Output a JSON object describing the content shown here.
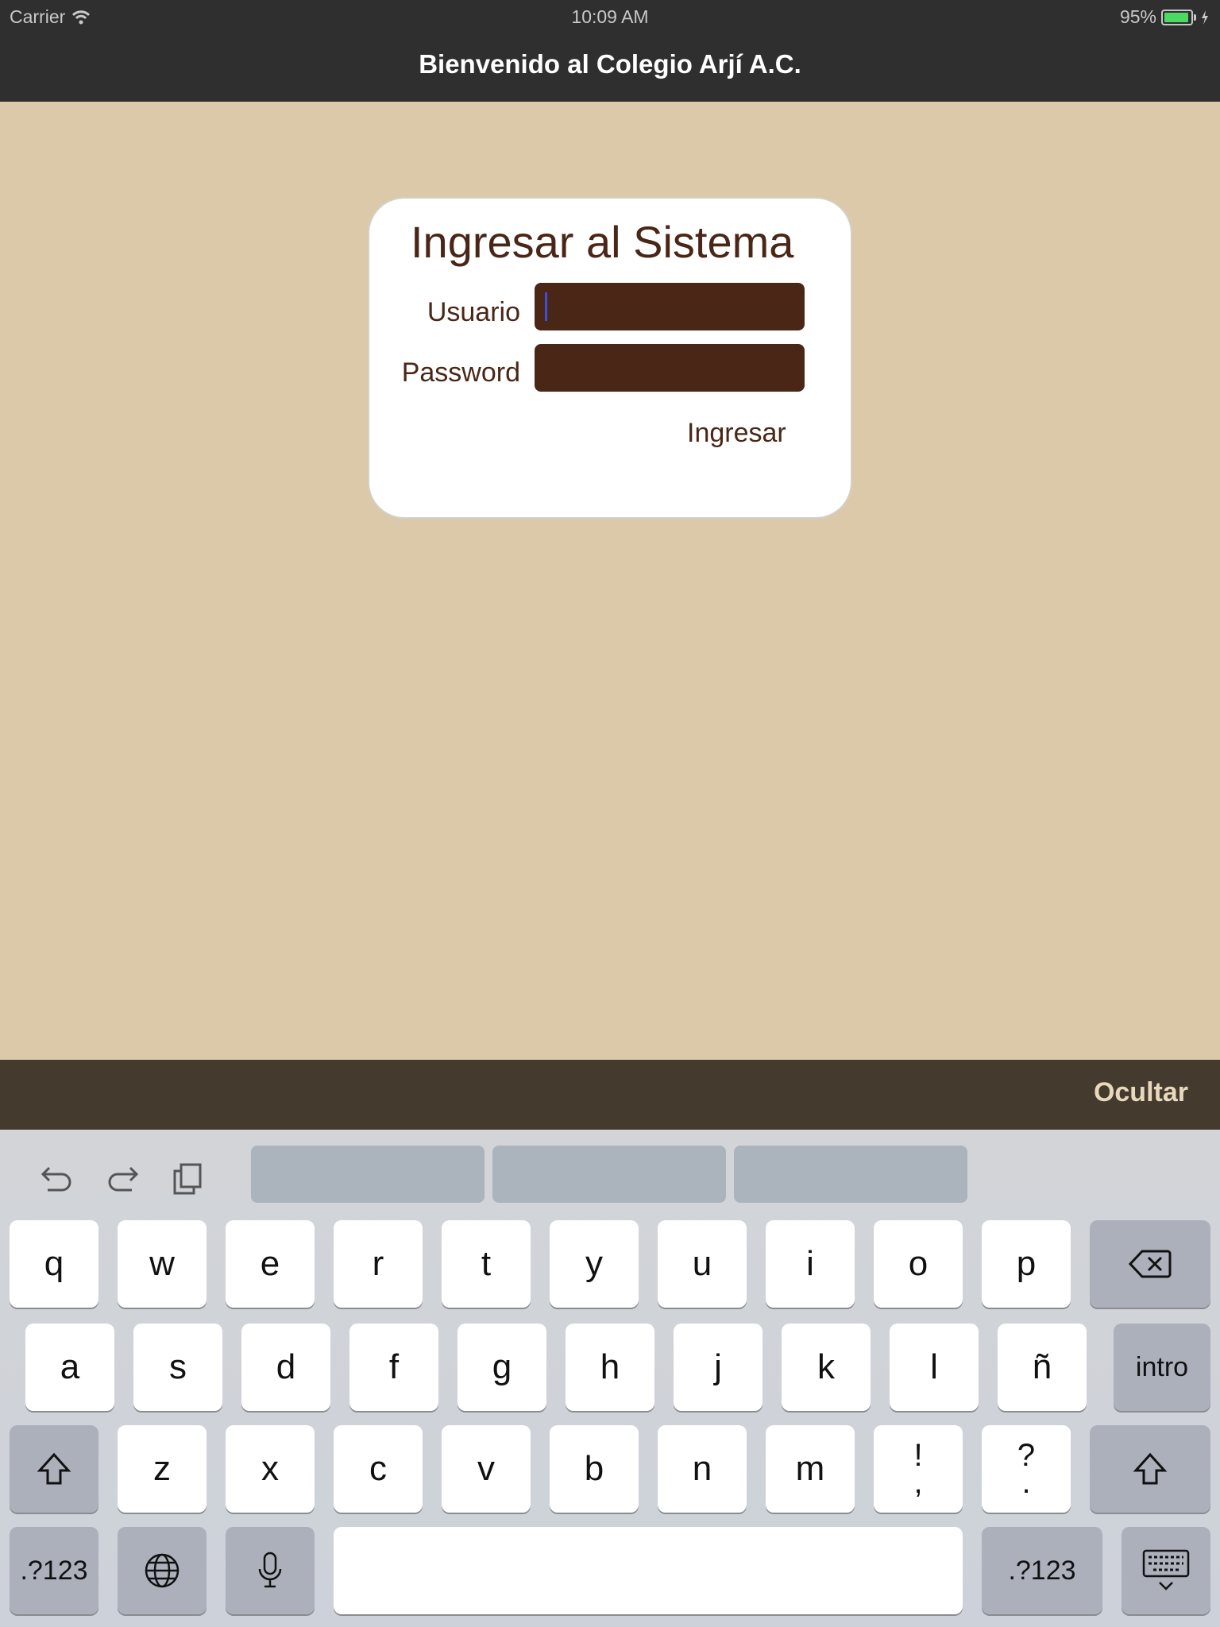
{
  "status_bar": {
    "carrier": "Carrier",
    "time": "10:09 AM",
    "battery": "95%",
    "battery_level": 0.95
  },
  "nav": {
    "title": "Bienvenido al Colegio Arjí A.C."
  },
  "login": {
    "title": "Ingresar al Sistema",
    "user_label": "Usuario",
    "user_value": "",
    "password_label": "Password",
    "password_value": "",
    "submit_label": "Ingresar"
  },
  "accessory": {
    "hide_label": "Ocultar"
  },
  "keyboard": {
    "row1": [
      "q",
      "w",
      "e",
      "r",
      "t",
      "y",
      "u",
      "i",
      "o",
      "p"
    ],
    "row2": [
      "a",
      "s",
      "d",
      "f",
      "g",
      "h",
      "j",
      "k",
      "l",
      "ñ"
    ],
    "row2_return": "intro",
    "row3": [
      "z",
      "x",
      "c",
      "v",
      "b",
      "n",
      "m"
    ],
    "row3_punct": [
      {
        "top": "!",
        "bottom": ","
      },
      {
        "top": "?",
        "bottom": "."
      }
    ],
    "numbers_label": ".?123"
  },
  "colors": {
    "background": "#dbc9a9",
    "brand_brown": "#4a2617",
    "nav_bar": "#2f2f2f",
    "accessory_bar": "#453a2e"
  }
}
